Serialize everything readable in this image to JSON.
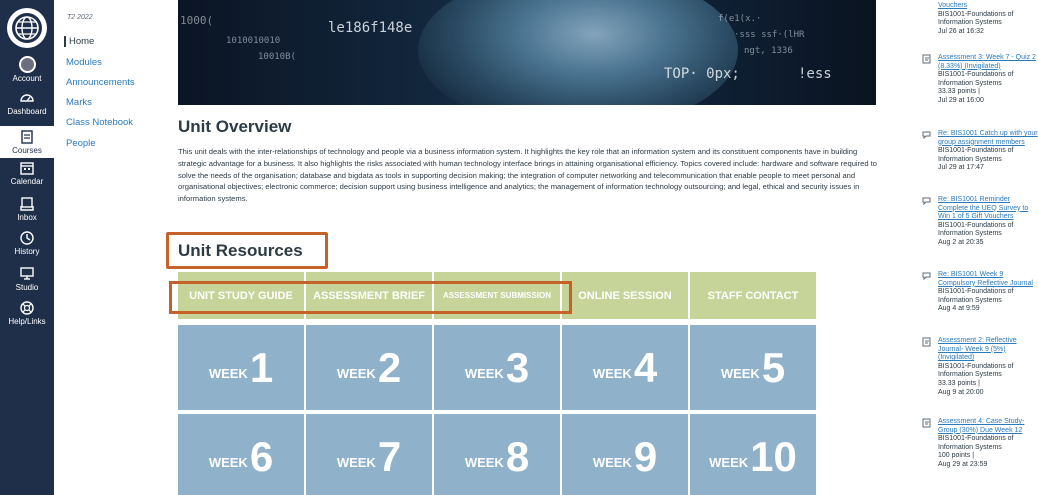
{
  "global_nav": {
    "items": [
      {
        "label": "Account"
      },
      {
        "label": "Dashboard"
      },
      {
        "label": "Courses"
      },
      {
        "label": "Calendar"
      },
      {
        "label": "Inbox"
      },
      {
        "label": "History"
      },
      {
        "label": "Studio"
      },
      {
        "label": "Help/Links"
      }
    ],
    "active": "Courses"
  },
  "course_nav": {
    "term": "T2 2022",
    "items": [
      {
        "label": "Home"
      },
      {
        "label": "Modules"
      },
      {
        "label": "Announcements"
      },
      {
        "label": "Marks"
      },
      {
        "label": "Class Notebook"
      },
      {
        "label": "People"
      }
    ],
    "active": "Home"
  },
  "banner": {
    "code_lines": [
      "1000(",
      "le186f148e",
      "1010010010",
      "10010B(",
      "TOP· 0px;",
      "f(e1(x.·",
      "·sss ssf·(lHR",
      "ngt, 1336",
      "!ess"
    ]
  },
  "overview": {
    "heading": "Unit Overview",
    "paragraph": "This unit deals with the inter-relationships of technology and people via a business information system. It highlights the key role that an information system and its constituent components have in building strategic advantage for a business. It also highlights the risks associated with human technology interface brings in attaining organisational efficiency. Topics covered include: hardware and software required to solve the needs of the organisation; database and bigdata as tools in supporting decision making; the integration of computer networking and telecommunication that enable people to meet personal and organisational objectives; electronic commerce; decision support using business intelligence and analytics; the management of information technology outsourcing; and legal, ethical and security issues in information systems."
  },
  "resources": {
    "heading": "Unit Resources",
    "tabs": [
      {
        "label": "UNIT STUDY GUIDE"
      },
      {
        "label": "ASSESSMENT BRIEF"
      },
      {
        "label": "ASSESSMENT SUBMISSION"
      },
      {
        "label": "ONLINE SESSION"
      },
      {
        "label": "STAFF CONTACT"
      }
    ],
    "week_word": "WEEK",
    "weeks": [
      "1",
      "2",
      "3",
      "4",
      "5",
      "6",
      "7",
      "8",
      "9",
      "10"
    ]
  },
  "sidebar": {
    "items": [
      {
        "icon": "assignment-icon",
        "link": "Vouchers",
        "course": "BIS1001-Foundations of Information Systems",
        "points": "",
        "date": "Jul 26 at 16:32"
      },
      {
        "icon": "assignment-icon",
        "link": "Assessment 3: Week 7 - Quiz 2 (8.33%) (Invigilated)",
        "course": "BIS1001-Foundations of Information Systems",
        "points": "33.33 points |",
        "date": "Jul 29 at 16:00"
      },
      {
        "icon": "discussion-icon",
        "link": "Re: BIS1001 Catch up with your group assignment members",
        "course": "BIS1001-Foundations of Information Systems",
        "points": "",
        "date": "Jul 29 at 17:47"
      },
      {
        "icon": "discussion-icon",
        "link": "Re: BIS1001 Reminder Complete the UEQ Survey to Win 1 of 5 Gift Vouchers",
        "course": "BIS1001-Foundations of Information Systems",
        "points": "",
        "date": "Aug 2 at 20:35"
      },
      {
        "icon": "discussion-icon",
        "link": "Re: BIS1001 Week 9 Compulsory Reflective Journal",
        "course": "BIS1001-Foundations of Information Systems",
        "points": "",
        "date": "Aug 4 at 9:59"
      },
      {
        "icon": "assignment-icon",
        "link": "Assessment 2: Reflective Journal- Week 9 (5%) (Invigilated)",
        "course": "BIS1001-Foundations of Information Systems",
        "points": "33.33 points |",
        "date": "Aug 9 at 20:00"
      },
      {
        "icon": "assignment-icon",
        "link": "Assessment 4: Case Study- Group (30%) Due Week 12",
        "course": "BIS1001-Foundations of Information Systems",
        "points": "100 points |",
        "date": "Aug 29 at 23:59"
      }
    ]
  },
  "colors": {
    "nav_bg": "#1f2f4a",
    "link": "#2b7abc",
    "highlight_frame": "#c5622a",
    "tab_green": "#c7d499",
    "week_blue": "#8fb1c9"
  }
}
